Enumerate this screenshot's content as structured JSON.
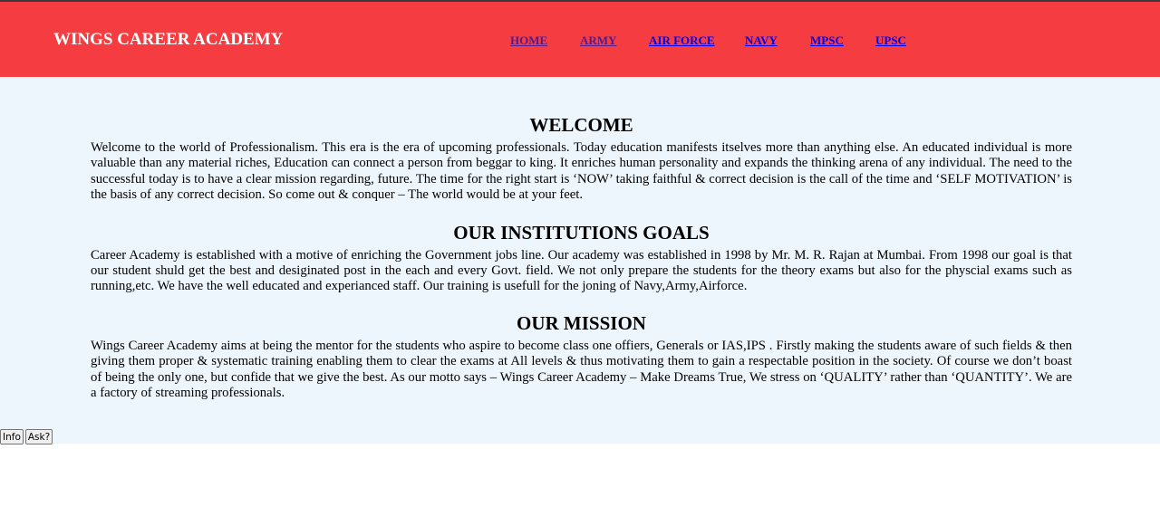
{
  "header": {
    "brand": "WINGS CAREER ACADEMY",
    "nav": [
      {
        "label": "HOME"
      },
      {
        "label": "ARMY"
      },
      {
        "label": "AIR FORCE"
      },
      {
        "label": "NAVY"
      },
      {
        "label": "MPSC"
      },
      {
        "label": "UPSC"
      }
    ]
  },
  "sections": [
    {
      "title": "WELCOME",
      "body": "Welcome to the world of Professionalism. This era is the era of upcoming professionals. Today education manifests itselves more than anything else. An educated individual is more valuable than any material riches, Education can connect a person from beggar to king. It enriches human personality and expands the thinking arena of any individual. The need to the successful today is to have a clear mission regarding, future. The time for the right start is ‘NOW’ taking faithful & correct decision is the call of the time and ‘SELF MOTIVATION’ is the basis of any correct decision. So come out & conquer – The world would be at your feet."
    },
    {
      "title": "OUR INSTITUTIONS GOALS",
      "body": "Career Academy is established with a motive of enriching the Government jobs line. Our academy was established in 1998 by Mr. M. R. Rajan at Mumbai. From 1998 our goal is that our student shuld get the best and desiginated post in the each and every Govt. field. We not only prepare the students for the theory exams but also for the physcial exams such as running,etc. We have the well educated and experianced staff. Our training is usefull for the joning of Navy,Army,Airforce."
    },
    {
      "title": "OUR MISSION",
      "body": "Wings Career Academy aims at being the mentor for the students who aspire to become class one offiers, Generals or IAS,IPS . Firstly making the students aware of such fields & then giving them proper & systematic training enabling them to clear the exams at All levels & thus motivating them to gain a respectable position in the society. Of course we don’t boast of being the only one, but confide that we give the best. As our motto says – Wings Career Academy – Make Dreams True, We stress on ‘QUALITY’ rather than ‘QUANTITY’. We are a factory of streaming professionals."
    }
  ],
  "buttons": {
    "info": "Info",
    "ask": "Ask?"
  }
}
